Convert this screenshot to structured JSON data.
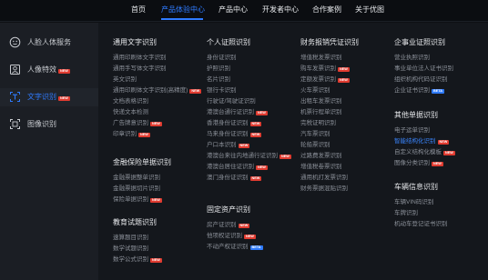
{
  "topnav": {
    "items": [
      "首页",
      "产品体验中心",
      "产品中心",
      "开发者中心",
      "合作案例",
      "关于优图"
    ],
    "active_index": 1
  },
  "sidebar": {
    "items": [
      {
        "label": "人脸人体服务",
        "icon": "face-icon"
      },
      {
        "label": "人像特效",
        "icon": "portrait-icon",
        "badge": "NEW"
      },
      {
        "label": "文字识别",
        "icon": "text-icon",
        "badge": "NEW",
        "active": true
      },
      {
        "label": "图像识别",
        "icon": "image-scan-icon"
      }
    ]
  },
  "columns": {
    "col1": {
      "sections": [
        {
          "title": "通用文字识别",
          "links": [
            {
              "label": "通用印刷体文字识别"
            },
            {
              "label": "通用手写体文字识别"
            },
            {
              "label": "英文识别"
            },
            {
              "label": "通用印刷体文字识别(高精度)",
              "badge": "NEW"
            },
            {
              "label": "文档表格识别"
            },
            {
              "label": "快递文本检测"
            },
            {
              "label": "广告牌意识别",
              "badge": "NEW"
            },
            {
              "label": "印章识别",
              "badge": "NEW"
            }
          ]
        },
        {
          "title": "金融保险单据识别",
          "links": [
            {
              "label": "金融票据整单识别"
            },
            {
              "label": "金融票据切片识别"
            },
            {
              "label": "保险单据识别",
              "badge": "NEW"
            }
          ]
        },
        {
          "title": "教育试题识别",
          "links": [
            {
              "label": "速算题目识别"
            },
            {
              "label": "数学试题识别"
            },
            {
              "label": "数学公式识别",
              "badge": "NEW"
            }
          ]
        }
      ]
    },
    "col2": {
      "sections": [
        {
          "title": "个人证照识别",
          "links": [
            {
              "label": "身份证识别"
            },
            {
              "label": "护照识别"
            },
            {
              "label": "名片识别"
            },
            {
              "label": "银行卡识别"
            },
            {
              "label": "行驶证/驾驶证识别"
            },
            {
              "label": "港澳台通行证识别",
              "badge": "NEW"
            },
            {
              "label": "香港身份证识别",
              "badge": "NEW"
            },
            {
              "label": "马来身份证识别",
              "badge": "NEW"
            },
            {
              "label": "户口本识别",
              "badge": "NEW"
            },
            {
              "label": "港澳台来往内地通行证识别",
              "badge": "NEW"
            },
            {
              "label": "港澳台居住证识别",
              "badge": "NEW"
            },
            {
              "label": "澳门身份证识别",
              "badge": "NEW"
            }
          ]
        },
        {
          "title": "固定资产识别",
          "links": [
            {
              "label": "房产证识别",
              "badge": "NEW"
            },
            {
              "label": "他项权证识别",
              "badge": "NEW"
            },
            {
              "label": "不动产权证识别",
              "badge": "BETA"
            }
          ]
        }
      ]
    },
    "col3": {
      "sections": [
        {
          "title": "财务报销凭证识别",
          "links": [
            {
              "label": "增值税发票识别"
            },
            {
              "label": "购车发票识别",
              "badge": "NEW"
            },
            {
              "label": "定额发票识别",
              "badge": "NEW"
            },
            {
              "label": "火车票识别"
            },
            {
              "label": "出租车发票识别"
            },
            {
              "label": "机票行程单识别"
            },
            {
              "label": "完税证明识别"
            },
            {
              "label": "汽车票识别"
            },
            {
              "label": "轮船票识别"
            },
            {
              "label": "过路费发票识别"
            },
            {
              "label": "增值税卷票识别"
            },
            {
              "label": "通用机打发票识别"
            },
            {
              "label": "财务票据混贴识别"
            }
          ]
        }
      ]
    },
    "col4": {
      "sections": [
        {
          "title": "企事业证照识别",
          "links": [
            {
              "label": "营业执照识别"
            },
            {
              "label": "事业单位法人证书识别"
            },
            {
              "label": "组织机构代码证识别"
            },
            {
              "label": "企业证书识别",
              "badge": "BETA"
            }
          ]
        },
        {
          "title": "其他单据识别",
          "links": [
            {
              "label": "电子运单识别"
            },
            {
              "label": "智能结构化识别",
              "badge": "NEW",
              "highlight": true
            },
            {
              "label": "自定义结构化模板",
              "badge": "NEW"
            },
            {
              "label": "图像分类识别",
              "badge": "NEW"
            }
          ]
        },
        {
          "title": "车辆信息识别",
          "links": [
            {
              "label": "车辆VIN码识别"
            },
            {
              "label": "车牌识别"
            },
            {
              "label": "机动车登记证书识别"
            }
          ]
        }
      ]
    }
  },
  "colors": {
    "accent": "#2f7bff",
    "new_badge": "#e03b30",
    "beta_badge": "#2f7bff"
  }
}
